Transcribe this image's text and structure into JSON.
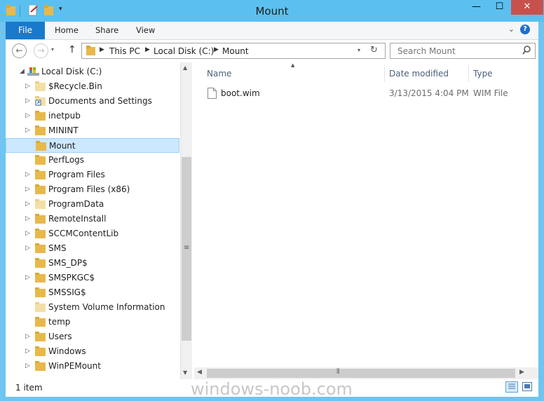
{
  "window": {
    "title": "Mount",
    "minimize_glyph": "—",
    "maximize_glyph": "☐",
    "close_glyph": "✕"
  },
  "ribbon": {
    "tabs": [
      "File",
      "Home",
      "Share",
      "View"
    ],
    "help_glyph": "?",
    "collapse_glyph": "⌄"
  },
  "address": {
    "crumbs": [
      "This PC",
      "Local Disk (C:)",
      "Mount"
    ],
    "search_placeholder": "Search Mount"
  },
  "nav_tree": {
    "root": "Local Disk (C:)",
    "items": [
      {
        "label": "$Recycle.Bin",
        "expandable": true,
        "icon": "folder-pale-icon"
      },
      {
        "label": "Documents and Settings",
        "expandable": true,
        "icon": "folder-shortcut-icon"
      },
      {
        "label": "inetpub",
        "expandable": true,
        "icon": "folder-icon"
      },
      {
        "label": "MININT",
        "expandable": true,
        "icon": "folder-icon"
      },
      {
        "label": "Mount",
        "expandable": false,
        "icon": "folder-icon",
        "selected": true
      },
      {
        "label": "PerfLogs",
        "expandable": false,
        "icon": "folder-icon"
      },
      {
        "label": "Program Files",
        "expandable": true,
        "icon": "folder-icon"
      },
      {
        "label": "Program Files (x86)",
        "expandable": true,
        "icon": "folder-icon"
      },
      {
        "label": "ProgramData",
        "expandable": true,
        "icon": "folder-pale-icon"
      },
      {
        "label": "RemoteInstall",
        "expandable": true,
        "icon": "folder-icon"
      },
      {
        "label": "SCCMContentLib",
        "expandable": true,
        "icon": "folder-icon"
      },
      {
        "label": "SMS",
        "expandable": true,
        "icon": "folder-icon"
      },
      {
        "label": "SMS_DP$",
        "expandable": false,
        "icon": "folder-icon"
      },
      {
        "label": "SMSPKGC$",
        "expandable": true,
        "icon": "folder-icon"
      },
      {
        "label": "SMSSIG$",
        "expandable": false,
        "icon": "folder-icon"
      },
      {
        "label": "System Volume Information",
        "expandable": false,
        "icon": "folder-pale-icon"
      },
      {
        "label": "temp",
        "expandable": false,
        "icon": "folder-icon"
      },
      {
        "label": "Users",
        "expandable": true,
        "icon": "folder-icon"
      },
      {
        "label": "Windows",
        "expandable": true,
        "icon": "folder-icon"
      },
      {
        "label": "WinPEMount",
        "expandable": true,
        "icon": "folder-icon"
      }
    ]
  },
  "file_list": {
    "columns": {
      "name": "Name",
      "date": "Date modified",
      "type": "Type"
    },
    "files": [
      {
        "name": "boot.wim",
        "date": "3/13/2015 4:04 PM",
        "type": "WIM File"
      }
    ]
  },
  "status": {
    "item_count": "1 item"
  },
  "watermark": "windows-noob.com",
  "colors": {
    "titlebar": "#5bc0ef",
    "file_tab": "#1979ca",
    "close": "#c7514d",
    "selection": "#cce8ff",
    "folder": "#e8b94a"
  }
}
